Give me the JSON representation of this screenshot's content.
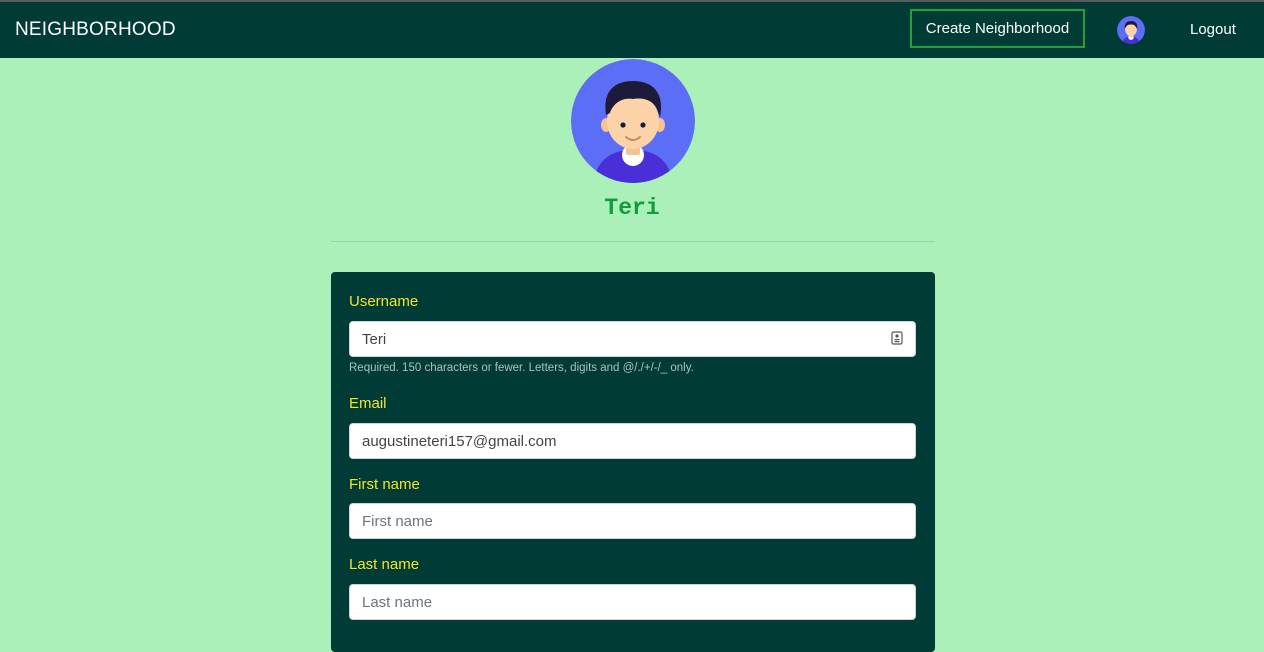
{
  "navbar": {
    "brand": "NEIGHBORHOOD",
    "create_label": "Create Neighborhood",
    "logout_label": "Logout"
  },
  "profile": {
    "name": "Teri"
  },
  "form": {
    "username": {
      "label": "Username",
      "value": "Teri",
      "help": "Required. 150 characters or fewer. Letters, digits and @/./+/-/_ only."
    },
    "email": {
      "label": "Email",
      "value": "augustineteri157@gmail.com"
    },
    "first_name": {
      "label": "First name",
      "placeholder": "First name",
      "value": ""
    },
    "last_name": {
      "label": "Last name",
      "placeholder": "Last name",
      "value": ""
    }
  },
  "colors": {
    "navbar_bg": "#003b36",
    "page_bg": "#abf0b8",
    "label_yellow": "#f2e52a",
    "name_green": "#0e9e3c",
    "button_border": "#1fa23a"
  },
  "icons": {
    "nav_avatar": "user-avatar-icon",
    "profile_avatar": "user-avatar-icon",
    "autofill": "contact-card-icon"
  }
}
